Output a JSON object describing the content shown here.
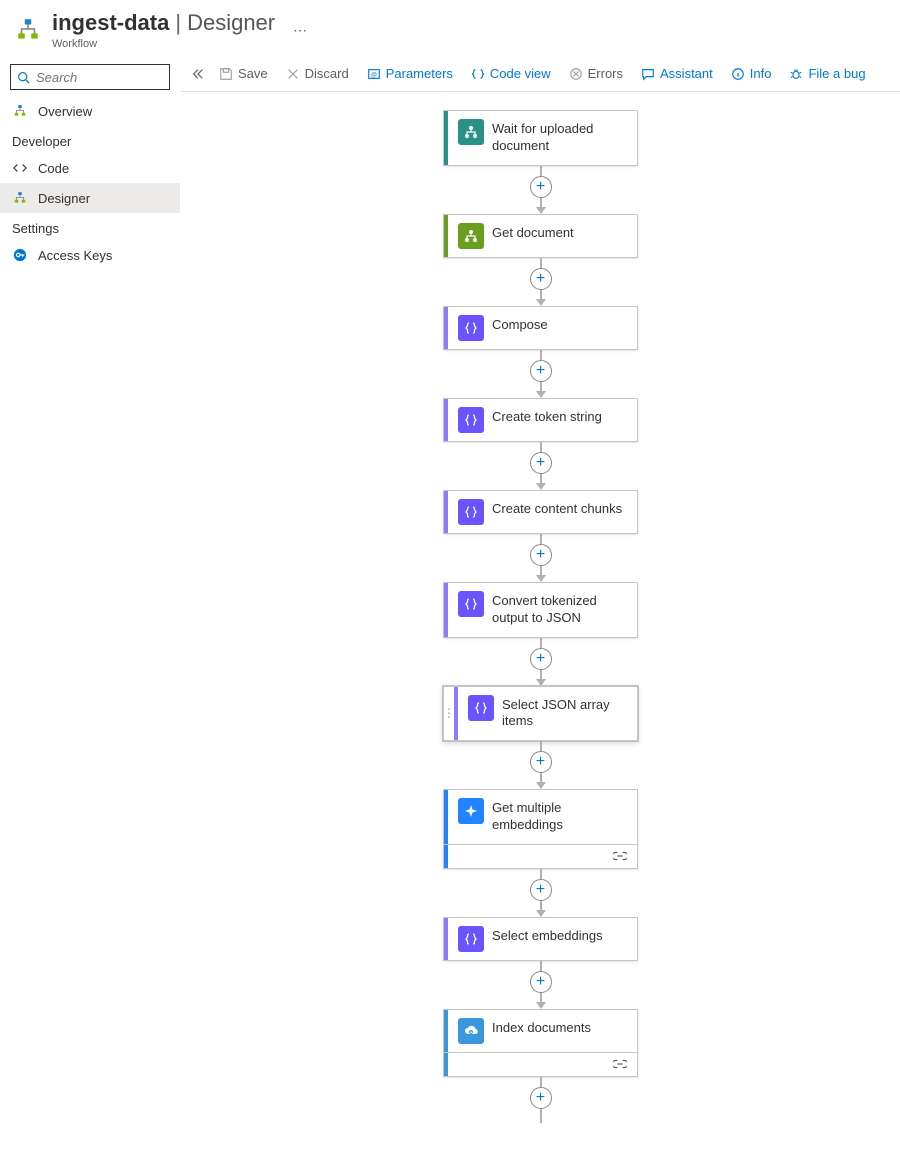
{
  "header": {
    "name": "ingest-data",
    "page": "Designer",
    "breadcrumb": "Workflow"
  },
  "search": {
    "placeholder": "Search"
  },
  "sidebar": {
    "items": [
      {
        "label": "Overview"
      }
    ],
    "devGroup": "Developer",
    "devItems": [
      {
        "label": "Code"
      },
      {
        "label": "Designer",
        "active": true
      }
    ],
    "settingsGroup": "Settings",
    "settingsItems": [
      {
        "label": "Access Keys"
      }
    ]
  },
  "toolbar": {
    "save": "Save",
    "discard": "Discard",
    "parameters": "Parameters",
    "codeview": "Code view",
    "errors": "Errors",
    "assistant": "Assistant",
    "info": "Info",
    "bug": "File a bug"
  },
  "nodes": [
    {
      "label": "Wait for uploaded document",
      "iconBg": "#2a9187",
      "accent": "#2a9187",
      "iconType": "tree"
    },
    {
      "label": "Get document",
      "iconBg": "#6a9e1f",
      "accent": "#6a9e1f",
      "iconType": "tree"
    },
    {
      "label": "Compose",
      "iconBg": "#6b53ff",
      "accent": "#8c7bff",
      "iconType": "brace"
    },
    {
      "label": "Create token string",
      "iconBg": "#6b53ff",
      "accent": "#8c7bff",
      "iconType": "brace"
    },
    {
      "label": "Create content chunks",
      "iconBg": "#6b53ff",
      "accent": "#8c7bff",
      "iconType": "brace"
    },
    {
      "label": "Convert tokenized output to JSON",
      "iconBg": "#6b53ff",
      "accent": "#8c7bff",
      "iconType": "brace"
    },
    {
      "label": "Select JSON array items",
      "iconBg": "#6b53ff",
      "accent": "#8c7bff",
      "iconType": "brace",
      "selected": true
    },
    {
      "label": "Get multiple embeddings",
      "iconBg": "#2183ff",
      "accent": "#2183ff",
      "iconType": "sparkle",
      "footer": true
    },
    {
      "label": "Select embeddings",
      "iconBg": "#6b53ff",
      "accent": "#8c7bff",
      "iconType": "brace"
    },
    {
      "label": "Index documents",
      "iconBg": "#3a96dd",
      "accent": "#3a96dd",
      "iconType": "cloud",
      "footer": true
    }
  ]
}
